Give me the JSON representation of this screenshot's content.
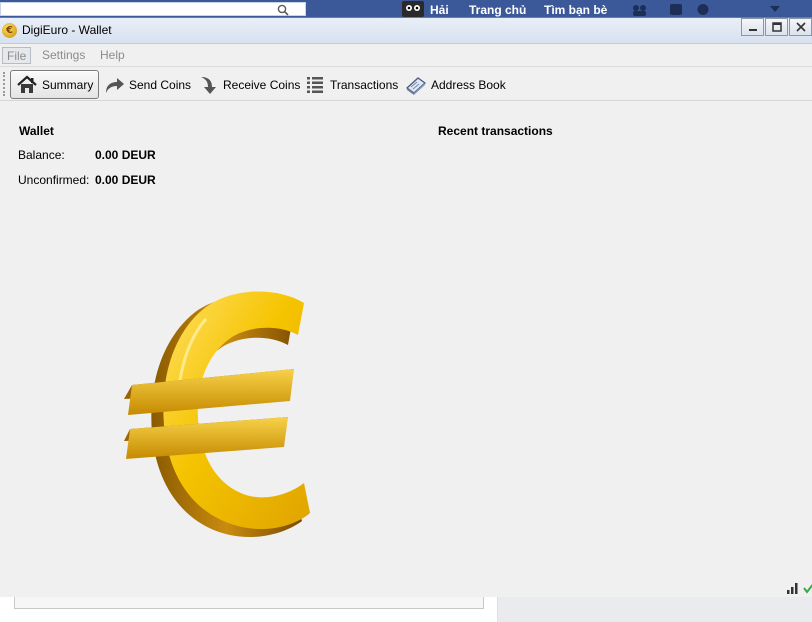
{
  "background": {
    "profile_name": "Hải",
    "links": [
      "Trang chủ",
      "Tìm bạn bè"
    ]
  },
  "window": {
    "title": "DigiEuro - Wallet",
    "app_icon": "euro-coin-icon",
    "controls": [
      "minimize-icon",
      "maximize-icon",
      "close-icon"
    ]
  },
  "menu": {
    "file": "File",
    "settings": "Settings",
    "help": "Help"
  },
  "toolbar": {
    "summary": "Summary",
    "send": "Send Coins",
    "receive": "Receive Coins",
    "transactions": "Transactions",
    "address_book": "Address Book"
  },
  "wallet": {
    "heading": "Wallet",
    "balance_label": "Balance:",
    "balance_value": "0.00 DEUR",
    "unconfirmed_label": "Unconfirmed:",
    "unconfirmed_value": "0.00 DEUR"
  },
  "recent": {
    "heading": "Recent transactions"
  },
  "status": {
    "icons": [
      "signal-strength-icon",
      "sync-check-icon"
    ]
  },
  "colors": {
    "facebook_bar": "#3b5998",
    "window_bg": "#f0f0f0",
    "euro_gold": "#f2c200"
  }
}
